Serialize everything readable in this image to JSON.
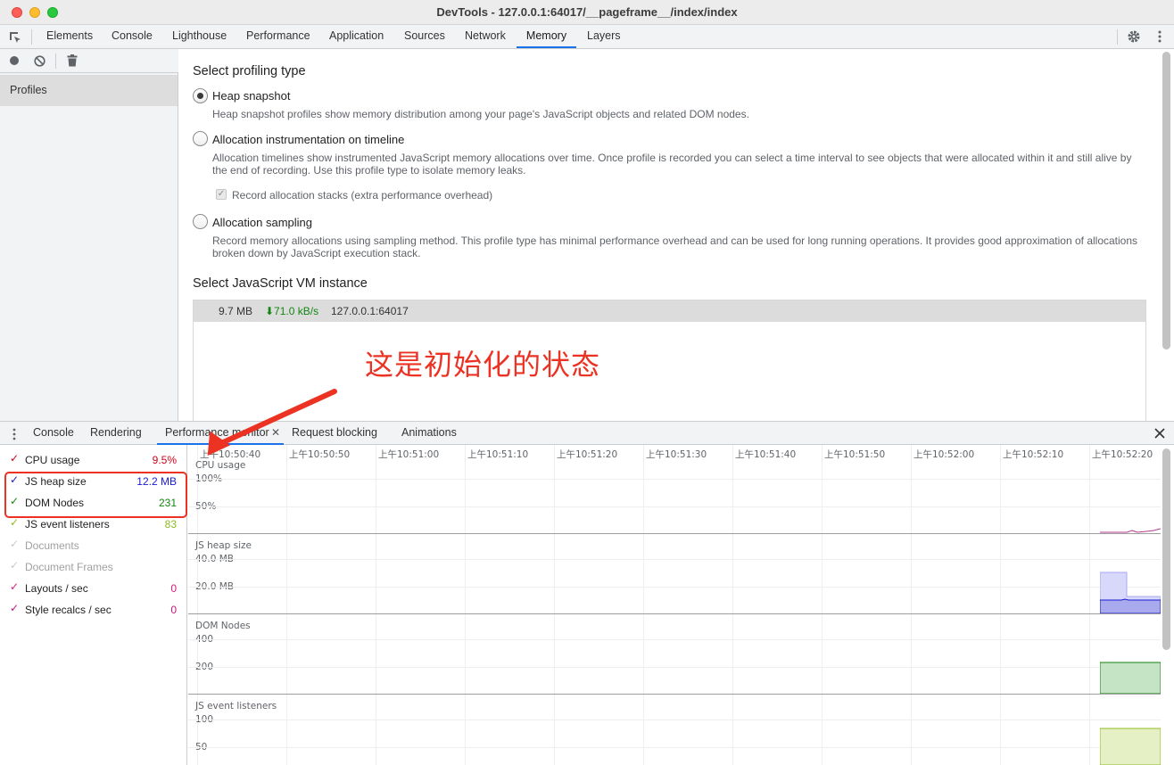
{
  "window": {
    "title": "DevTools - 127.0.0.1:64017/__pageframe__/index/index"
  },
  "main_tabs": [
    {
      "label": "Elements"
    },
    {
      "label": "Console"
    },
    {
      "label": "Lighthouse"
    },
    {
      "label": "Performance"
    },
    {
      "label": "Application"
    },
    {
      "label": "Sources"
    },
    {
      "label": "Network"
    },
    {
      "label": "Memory",
      "active": true
    },
    {
      "label": "Layers"
    }
  ],
  "sidebar": {
    "profiles_label": "Profiles"
  },
  "memory": {
    "select_type_title": "Select profiling type",
    "options": [
      {
        "label": "Heap snapshot",
        "checked": true,
        "description": "Heap snapshot profiles show memory distribution among your page's JavaScript objects and related DOM nodes."
      },
      {
        "label": "Allocation instrumentation on timeline",
        "checked": false,
        "description": "Allocation timelines show instrumented JavaScript memory allocations over time. Once profile is recorded you can select a time interval to see objects that were allocated within it and still alive by the end of recording. Use this profile type to isolate memory leaks."
      },
      {
        "label": "Allocation sampling",
        "checked": false,
        "description": "Record memory allocations using sampling method. This profile type has minimal performance overhead and can be used for long running operations. It provides good approximation of allocations broken down by JavaScript execution stack."
      }
    ],
    "record_stacks_label": "Record allocation stacks (extra performance overhead)",
    "record_stacks_checked": true,
    "select_vm_title": "Select JavaScript VM instance",
    "vm_instance": {
      "size": "9.7 MB",
      "rate": "⬇71.0 kB/s",
      "host": "127.0.0.1:64017"
    }
  },
  "annotation": {
    "text": "这是初始化的状态"
  },
  "drawer_tabs": [
    {
      "label": "Console"
    },
    {
      "label": "Rendering"
    },
    {
      "label": "Performance monitor",
      "active": true,
      "closable": true
    },
    {
      "label": "Request blocking"
    },
    {
      "label": "Animations"
    }
  ],
  "metrics": [
    {
      "label": "CPU usage",
      "value": "9.5%",
      "color": "#d0021b",
      "checked": true
    },
    {
      "label": "JS heap size",
      "value": "12.2 MB",
      "color": "#1a1ad3",
      "checked": true
    },
    {
      "label": "DOM Nodes",
      "value": "231",
      "color": "#138612",
      "checked": true
    },
    {
      "label": "JS event listeners",
      "value": "83",
      "color": "#8fbc20",
      "checked": true
    },
    {
      "label": "Documents",
      "value": "",
      "color": "#c8c8c8",
      "checked": false
    },
    {
      "label": "Document Frames",
      "value": "",
      "color": "#c8c8c8",
      "checked": false
    },
    {
      "label": "Layouts / sec",
      "value": "0",
      "color": "#e0167d",
      "checked": true
    },
    {
      "label": "Style recalcs / sec",
      "value": "0",
      "color": "#c4147d",
      "checked": true
    }
  ],
  "timeline": {
    "labels": [
      "上午10:50:40",
      "上午10:50:50",
      "上午10:51:00",
      "上午10:51:10",
      "上午10:51:20",
      "上午10:51:30",
      "上午10:51:40",
      "上午10:51:50",
      "上午10:52:00",
      "上午10:52:10",
      "上午10:52:20"
    ]
  },
  "panes": [
    {
      "title": "CPU usage",
      "ticks": [
        "100%",
        "50%"
      ]
    },
    {
      "title": "JS heap size",
      "ticks": [
        "40.0 MB",
        "20.0 MB"
      ]
    },
    {
      "title": "DOM Nodes",
      "ticks": [
        "400",
        "200"
      ]
    },
    {
      "title": "JS event listeners",
      "ticks": [
        "100",
        "50"
      ]
    }
  ]
}
